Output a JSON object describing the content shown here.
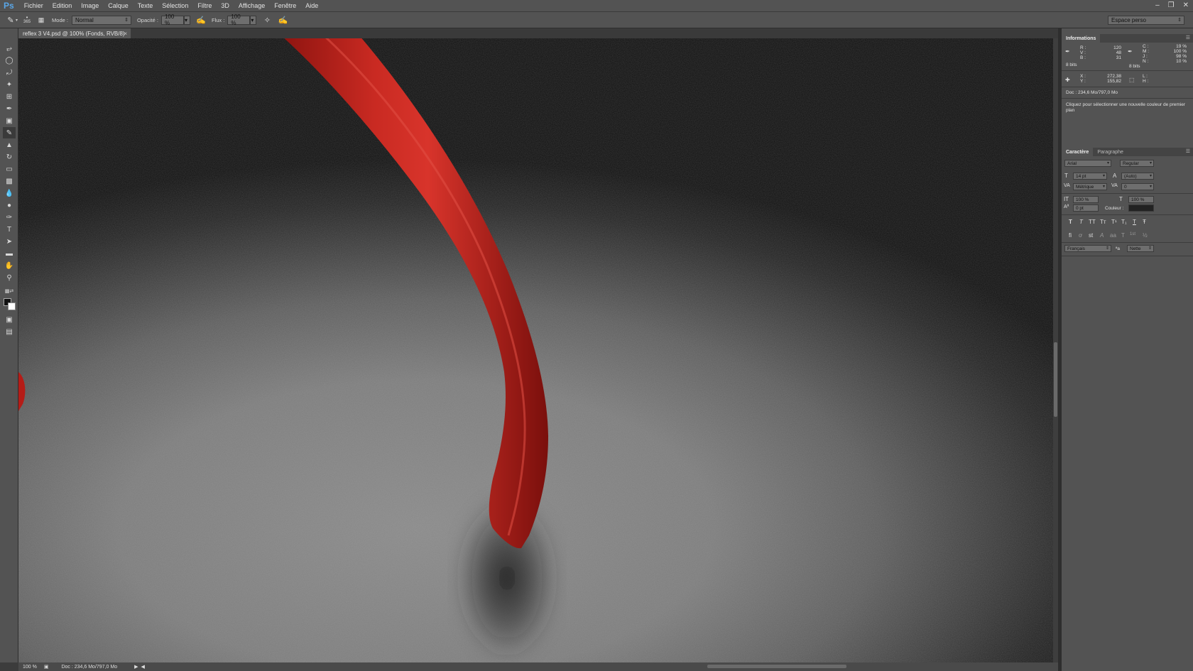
{
  "app": {
    "logo": "Ps"
  },
  "menu": [
    "Fichier",
    "Edition",
    "Image",
    "Calque",
    "Texte",
    "Sélection",
    "Filtre",
    "3D",
    "Affichage",
    "Fenêtre",
    "Aide"
  ],
  "options": {
    "brush_size": "365",
    "mode_label": "Mode :",
    "mode_value": "Normal",
    "opacity_label": "Opacité :",
    "opacity_value": "100 %",
    "flow_label": "Flux :",
    "flow_value": "100 %",
    "workspace": "Espace perso"
  },
  "document": {
    "tab_title": "reflex 3 V4.psd @ 100% (Fonds, RVB/8)",
    "close": "×"
  },
  "status": {
    "zoom": "100 %",
    "doc": "Doc : 234,6 Mo/797,0 Mo"
  },
  "info_panel": {
    "title": "Informations",
    "r_label": "R :",
    "r_value": "120",
    "v_label": "V :",
    "v_value": "48",
    "b_label": "B :",
    "b_value": "31",
    "bits_left": "8 bits",
    "c_label": "C :",
    "c_value": "19 %",
    "m_label": "M :",
    "m_value": "100 %",
    "j_label": "J :",
    "j_value": "98 %",
    "n_label": "N :",
    "n_value": "10 %",
    "bits_right": "8 bits",
    "x_label": "X :",
    "x_value": "272,38",
    "y_label": "Y :",
    "y_value": "155,82",
    "l_label": "L :",
    "h_label": "H :",
    "doc": "Doc : 234,6 Mo/797,0 Mo",
    "hint": "Cliquez pour sélectionner une nouvelle couleur de premier plan"
  },
  "char_panel": {
    "tab_active": "Caractère",
    "tab_other": "Paragraphe",
    "font": "Arial",
    "style": "Regular",
    "size": "14 pt",
    "leading": "(Auto)",
    "kerning": "Métrique",
    "tracking": "0",
    "vscale": "100 %",
    "hscale": "100 %",
    "baseline": "0 pt",
    "color_label": "Couleur :",
    "type_buttons": [
      "T",
      "T",
      "TT",
      "Tт",
      "T¹",
      "T₁",
      "T",
      "Ŧ"
    ],
    "ot_buttons": [
      "fi",
      "ơ",
      "st",
      "A",
      "aa",
      "T",
      "1st",
      "½"
    ],
    "language": "Français",
    "aa_label": "ªa",
    "antialias": "Nette"
  },
  "colors": {
    "accent_blue": "#5aa7e8",
    "panel_bg": "#535353",
    "dark_bg": "#3c3c3c",
    "ribbon_red": "#c9211c"
  }
}
